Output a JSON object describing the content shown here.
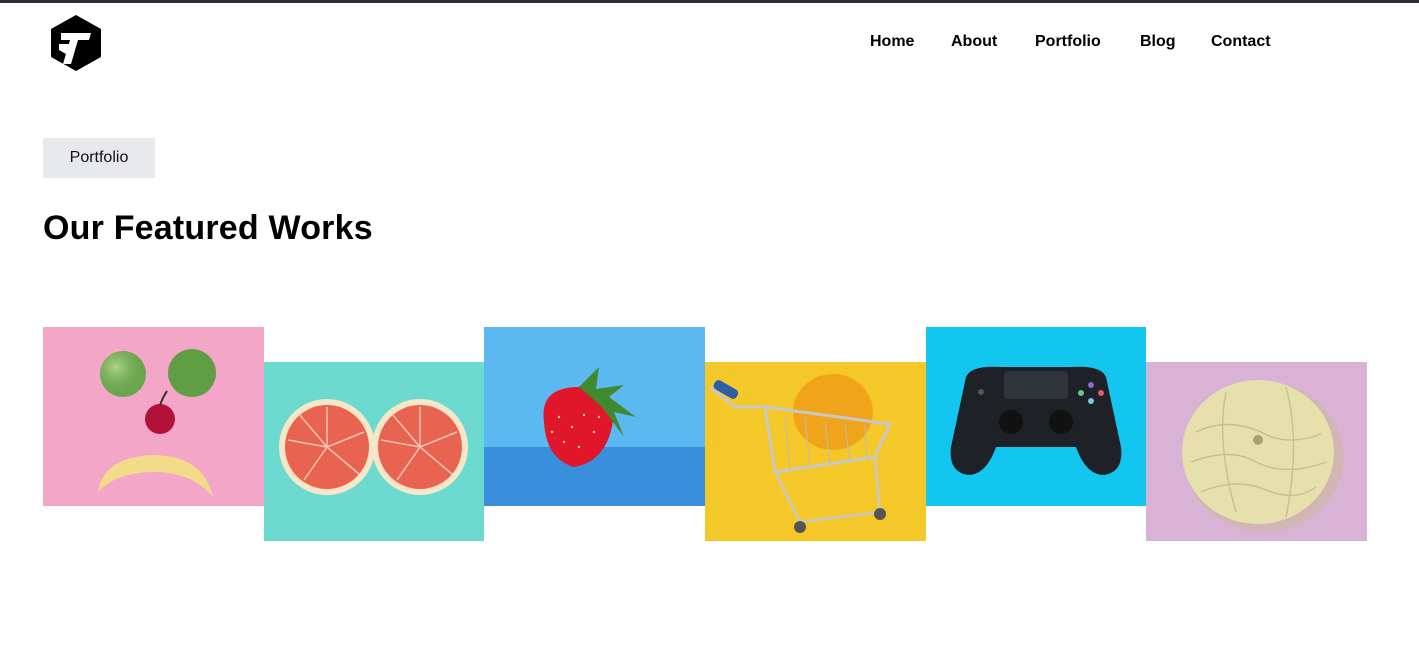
{
  "nav": {
    "items": [
      {
        "label": "Home"
      },
      {
        "label": "About"
      },
      {
        "label": "Portfolio"
      },
      {
        "label": "Blog"
      },
      {
        "label": "Contact"
      }
    ]
  },
  "hero": {
    "tag": "Portfolio",
    "title": "Our Featured Works"
  },
  "portfolio": {
    "items": [
      {
        "icon": "sad-fruit-face-image",
        "bg": "#f4a6c9"
      },
      {
        "icon": "grapefruit-halves-image",
        "bg": "#6ddad0"
      },
      {
        "icon": "strawberry-image",
        "bg": "#5cb8f0"
      },
      {
        "icon": "shopping-cart-lemon-image",
        "bg": "#f5c82a"
      },
      {
        "icon": "game-controller-image",
        "bg": "#12c6ef"
      },
      {
        "icon": "melon-image",
        "bg": "#d9b3d6"
      }
    ]
  }
}
